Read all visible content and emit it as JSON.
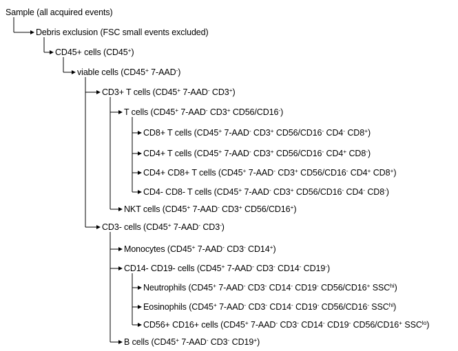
{
  "colors": {
    "line": "#000000",
    "text": "#000000",
    "background": "#ffffff"
  },
  "nodes": [
    {
      "id": "sample",
      "parent": null,
      "segments": [
        {
          "t": "Sample (all acquired events)"
        }
      ]
    },
    {
      "id": "debris",
      "parent": "sample",
      "segments": [
        {
          "t": "Debris exclusion (FSC small events excluded)"
        }
      ]
    },
    {
      "id": "cd45",
      "parent": "debris",
      "segments": [
        {
          "t": "CD45+ cells (CD45"
        },
        {
          "t": "+",
          "sup": true
        },
        {
          "t": ")"
        }
      ]
    },
    {
      "id": "viable",
      "parent": "cd45",
      "segments": [
        {
          "t": "viable cells (CD45"
        },
        {
          "t": "+",
          "sup": true
        },
        {
          "t": " 7-AAD"
        },
        {
          "t": "-",
          "sup": true
        },
        {
          "t": ")"
        }
      ]
    },
    {
      "id": "cd3pos",
      "parent": "viable",
      "segments": [
        {
          "t": "CD3+ T cells (CD45"
        },
        {
          "t": "+",
          "sup": true
        },
        {
          "t": " 7-AAD"
        },
        {
          "t": "-",
          "sup": true
        },
        {
          "t": " CD3"
        },
        {
          "t": "+",
          "sup": true
        },
        {
          "t": ")"
        }
      ]
    },
    {
      "id": "tcells",
      "parent": "cd3pos",
      "segments": [
        {
          "t": "T cells (CD45"
        },
        {
          "t": "+",
          "sup": true
        },
        {
          "t": " 7-AAD"
        },
        {
          "t": "-",
          "sup": true
        },
        {
          "t": " CD3"
        },
        {
          "t": "+",
          "sup": true
        },
        {
          "t": " CD56/CD16"
        },
        {
          "t": "-",
          "sup": true
        },
        {
          "t": ")"
        }
      ]
    },
    {
      "id": "cd8",
      "parent": "tcells",
      "segments": [
        {
          "t": "CD8+ T cells (CD45"
        },
        {
          "t": "+",
          "sup": true
        },
        {
          "t": " 7-AAD"
        },
        {
          "t": "-",
          "sup": true
        },
        {
          "t": " CD3"
        },
        {
          "t": "+",
          "sup": true
        },
        {
          "t": " CD56/CD16"
        },
        {
          "t": "-",
          "sup": true
        },
        {
          "t": " CD4"
        },
        {
          "t": "-",
          "sup": true
        },
        {
          "t": " CD8"
        },
        {
          "t": "+",
          "sup": true
        },
        {
          "t": ")"
        }
      ]
    },
    {
      "id": "cd4",
      "parent": "tcells",
      "segments": [
        {
          "t": "CD4+ T cells (CD45"
        },
        {
          "t": "+",
          "sup": true
        },
        {
          "t": " 7-AAD"
        },
        {
          "t": "-",
          "sup": true
        },
        {
          "t": " CD3"
        },
        {
          "t": "+",
          "sup": true
        },
        {
          "t": " CD56/CD16"
        },
        {
          "t": "-",
          "sup": true
        },
        {
          "t": " CD4"
        },
        {
          "t": "+",
          "sup": true
        },
        {
          "t": " CD8"
        },
        {
          "t": "-",
          "sup": true
        },
        {
          "t": ")"
        }
      ]
    },
    {
      "id": "cd4cd8",
      "parent": "tcells",
      "segments": [
        {
          "t": "CD4+ CD8+ T cells (CD45"
        },
        {
          "t": "+",
          "sup": true
        },
        {
          "t": " 7-AAD"
        },
        {
          "t": "-",
          "sup": true
        },
        {
          "t": " CD3"
        },
        {
          "t": "+",
          "sup": true
        },
        {
          "t": " CD56/CD16"
        },
        {
          "t": "-",
          "sup": true
        },
        {
          "t": " CD4"
        },
        {
          "t": "+",
          "sup": true
        },
        {
          "t": " CD8"
        },
        {
          "t": "+",
          "sup": true
        },
        {
          "t": ")"
        }
      ]
    },
    {
      "id": "dn",
      "parent": "tcells",
      "segments": [
        {
          "t": "CD4- CD8- T cells (CD45"
        },
        {
          "t": "+",
          "sup": true
        },
        {
          "t": " 7-AAD"
        },
        {
          "t": "-",
          "sup": true
        },
        {
          "t": " CD3"
        },
        {
          "t": "+",
          "sup": true
        },
        {
          "t": " CD56/CD16"
        },
        {
          "t": "-",
          "sup": true
        },
        {
          "t": " CD4"
        },
        {
          "t": "-",
          "sup": true
        },
        {
          "t": " CD8"
        },
        {
          "t": "-",
          "sup": true
        },
        {
          "t": ")"
        }
      ]
    },
    {
      "id": "nkt",
      "parent": "cd3pos",
      "segments": [
        {
          "t": "NKT cells (CD45"
        },
        {
          "t": "+",
          "sup": true
        },
        {
          "t": " 7-AAD"
        },
        {
          "t": "-",
          "sup": true
        },
        {
          "t": " CD3"
        },
        {
          "t": "+",
          "sup": true
        },
        {
          "t": " CD56/CD16"
        },
        {
          "t": "+",
          "sup": true
        },
        {
          "t": ")"
        }
      ]
    },
    {
      "id": "cd3neg",
      "parent": "viable",
      "segments": [
        {
          "t": "CD3- cells (CD45"
        },
        {
          "t": "+",
          "sup": true
        },
        {
          "t": " 7-AAD"
        },
        {
          "t": "-",
          "sup": true
        },
        {
          "t": " CD3"
        },
        {
          "t": "-",
          "sup": true
        },
        {
          "t": ")"
        }
      ]
    },
    {
      "id": "mono",
      "parent": "cd3neg",
      "segments": [
        {
          "t": "Monocytes (CD45"
        },
        {
          "t": "+",
          "sup": true
        },
        {
          "t": " 7-AAD"
        },
        {
          "t": "-",
          "sup": true
        },
        {
          "t": " CD3"
        },
        {
          "t": "-",
          "sup": true
        },
        {
          "t": " CD14"
        },
        {
          "t": "+",
          "sup": true
        },
        {
          "t": ")"
        }
      ]
    },
    {
      "id": "cd14cd19",
      "parent": "cd3neg",
      "segments": [
        {
          "t": "CD14- CD19- cells (CD45"
        },
        {
          "t": "+",
          "sup": true
        },
        {
          "t": " 7-AAD"
        },
        {
          "t": "-",
          "sup": true
        },
        {
          "t": " CD3"
        },
        {
          "t": "-",
          "sup": true
        },
        {
          "t": " CD14"
        },
        {
          "t": "-",
          "sup": true
        },
        {
          "t": " CD19"
        },
        {
          "t": "-",
          "sup": true
        },
        {
          "t": ")"
        }
      ]
    },
    {
      "id": "neutro",
      "parent": "cd14cd19",
      "segments": [
        {
          "t": "Neutrophils (CD45"
        },
        {
          "t": "+",
          "sup": true
        },
        {
          "t": " 7-AAD"
        },
        {
          "t": "-",
          "sup": true
        },
        {
          "t": " CD3"
        },
        {
          "t": "-",
          "sup": true
        },
        {
          "t": " CD14"
        },
        {
          "t": "-",
          "sup": true
        },
        {
          "t": " CD19"
        },
        {
          "t": "-",
          "sup": true
        },
        {
          "t": " CD56/CD16"
        },
        {
          "t": "+",
          "sup": true
        },
        {
          "t": " SSC"
        },
        {
          "t": "hi",
          "sup": true
        },
        {
          "t": ")"
        }
      ]
    },
    {
      "id": "eosino",
      "parent": "cd14cd19",
      "segments": [
        {
          "t": "Eosinophils (CD45"
        },
        {
          "t": "+",
          "sup": true
        },
        {
          "t": " 7-AAD"
        },
        {
          "t": "-",
          "sup": true
        },
        {
          "t": " CD3"
        },
        {
          "t": "-",
          "sup": true
        },
        {
          "t": " CD14"
        },
        {
          "t": "-",
          "sup": true
        },
        {
          "t": " CD19"
        },
        {
          "t": "-",
          "sup": true
        },
        {
          "t": " CD56/CD16"
        },
        {
          "t": "-",
          "sup": true
        },
        {
          "t": " SSC"
        },
        {
          "t": "hi",
          "sup": true
        },
        {
          "t": ")"
        }
      ]
    },
    {
      "id": "cd56cd16",
      "parent": "cd14cd19",
      "segments": [
        {
          "t": "CD56+ CD16+ cells (CD45"
        },
        {
          "t": "+",
          "sup": true
        },
        {
          "t": " 7-AAD"
        },
        {
          "t": "-",
          "sup": true
        },
        {
          "t": " CD3"
        },
        {
          "t": "-",
          "sup": true
        },
        {
          "t": " CD14"
        },
        {
          "t": "-",
          "sup": true
        },
        {
          "t": " CD19"
        },
        {
          "t": "-",
          "sup": true
        },
        {
          "t": " CD56/CD16"
        },
        {
          "t": "+",
          "sup": true
        },
        {
          "t": " SSC"
        },
        {
          "t": "lo",
          "sup": true
        },
        {
          "t": ")"
        }
      ]
    },
    {
      "id": "bcells",
      "parent": "cd3neg",
      "segments": [
        {
          "t": "B cells (CD45"
        },
        {
          "t": "+",
          "sup": true
        },
        {
          "t": " 7-AAD"
        },
        {
          "t": "-",
          "sup": true
        },
        {
          "t": " CD3"
        },
        {
          "t": "-",
          "sup": true
        },
        {
          "t": " CD19"
        },
        {
          "t": "+",
          "sup": true
        },
        {
          "t": ")"
        }
      ]
    }
  ]
}
